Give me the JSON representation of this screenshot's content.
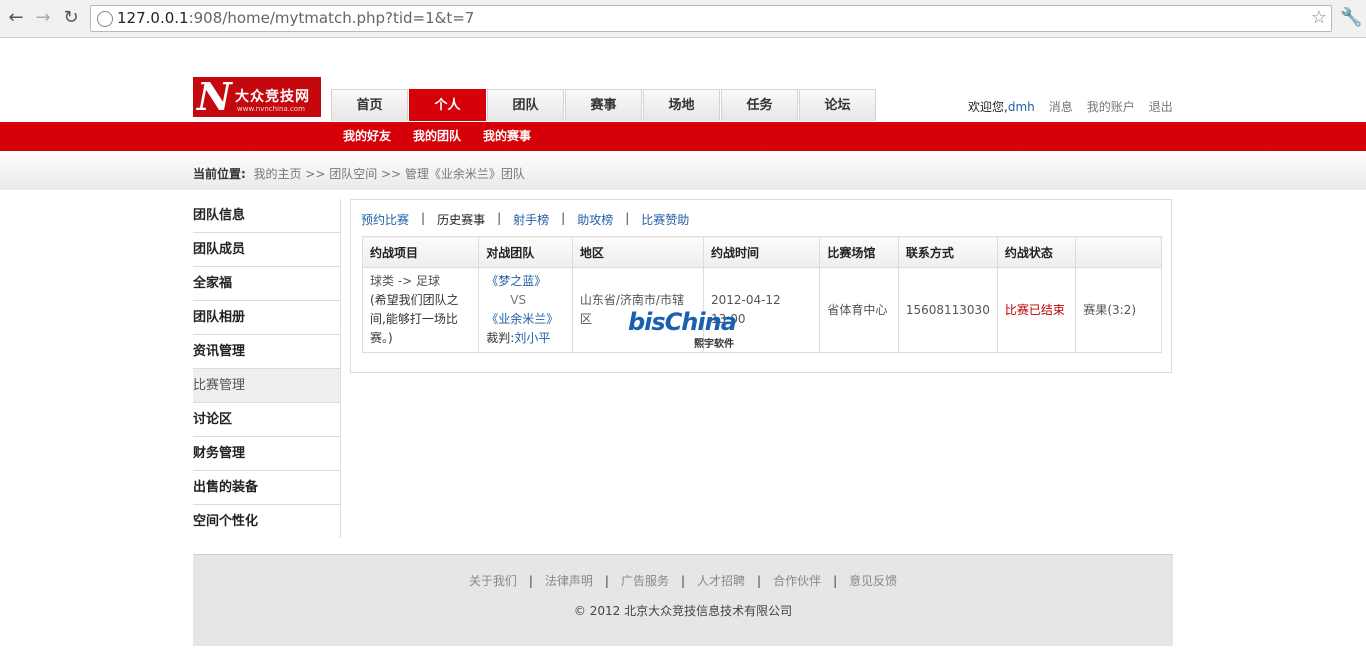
{
  "browser": {
    "url_host": "127.0.0.1",
    "url_rest": ":908/home/mytmatch.php?tid=1&t=7"
  },
  "logo": {
    "mark": "N",
    "name": "大众竞技网",
    "domain": "www.nvnchina.com"
  },
  "mainnav": [
    "首页",
    "个人",
    "团队",
    "赛事",
    "场地",
    "任务",
    "论坛"
  ],
  "userbar": {
    "welcome": "欢迎您,",
    "username": "dmh",
    "links": [
      "消息",
      "我的账户",
      "退出"
    ]
  },
  "subnav": [
    "我的好友",
    "我的团队",
    "我的赛事"
  ],
  "breadcrumb": {
    "label": "当前位置:",
    "path": "我的主页 >> 团队空间 >> 管理《业余米兰》团队"
  },
  "sidebar": [
    "团队信息",
    "团队成员",
    "全家福",
    "团队相册",
    "资讯管理",
    "比赛管理",
    "讨论区",
    "财务管理",
    "出售的装备",
    "空间个性化"
  ],
  "content_tabs": [
    "预约比赛",
    "历史赛事",
    "射手榜",
    "助攻榜",
    "比赛赞助"
  ],
  "table": {
    "headers": [
      "约战项目",
      "对战团队",
      "地区",
      "约战时间",
      "比赛场馆",
      "联系方式",
      "约战状态",
      ""
    ],
    "row": {
      "item_category": "球类 -> 足球",
      "item_note": "(希望我们团队之间,能够打一场比赛。)",
      "team_a": "《梦之蓝》",
      "vs": "VS",
      "team_b": "《业余米兰》",
      "referee_label": "裁判:",
      "referee_name": "刘小平",
      "region": "山东省/济南市/市辖区",
      "time": "2012-04-12 13:00",
      "venue": "省体育中心",
      "contact": "15608113030",
      "status": "比赛已结束",
      "result": "赛果(3:2)"
    }
  },
  "watermark": {
    "brand": "bisChina",
    "sub": "熙宇软件"
  },
  "footer": {
    "links": [
      "关于我们",
      "法律声明",
      "广告服务",
      "人才招聘",
      "合作伙伴",
      "意见反馈"
    ],
    "copyright": "© 2012 北京大众竞技信息技术有限公司"
  }
}
